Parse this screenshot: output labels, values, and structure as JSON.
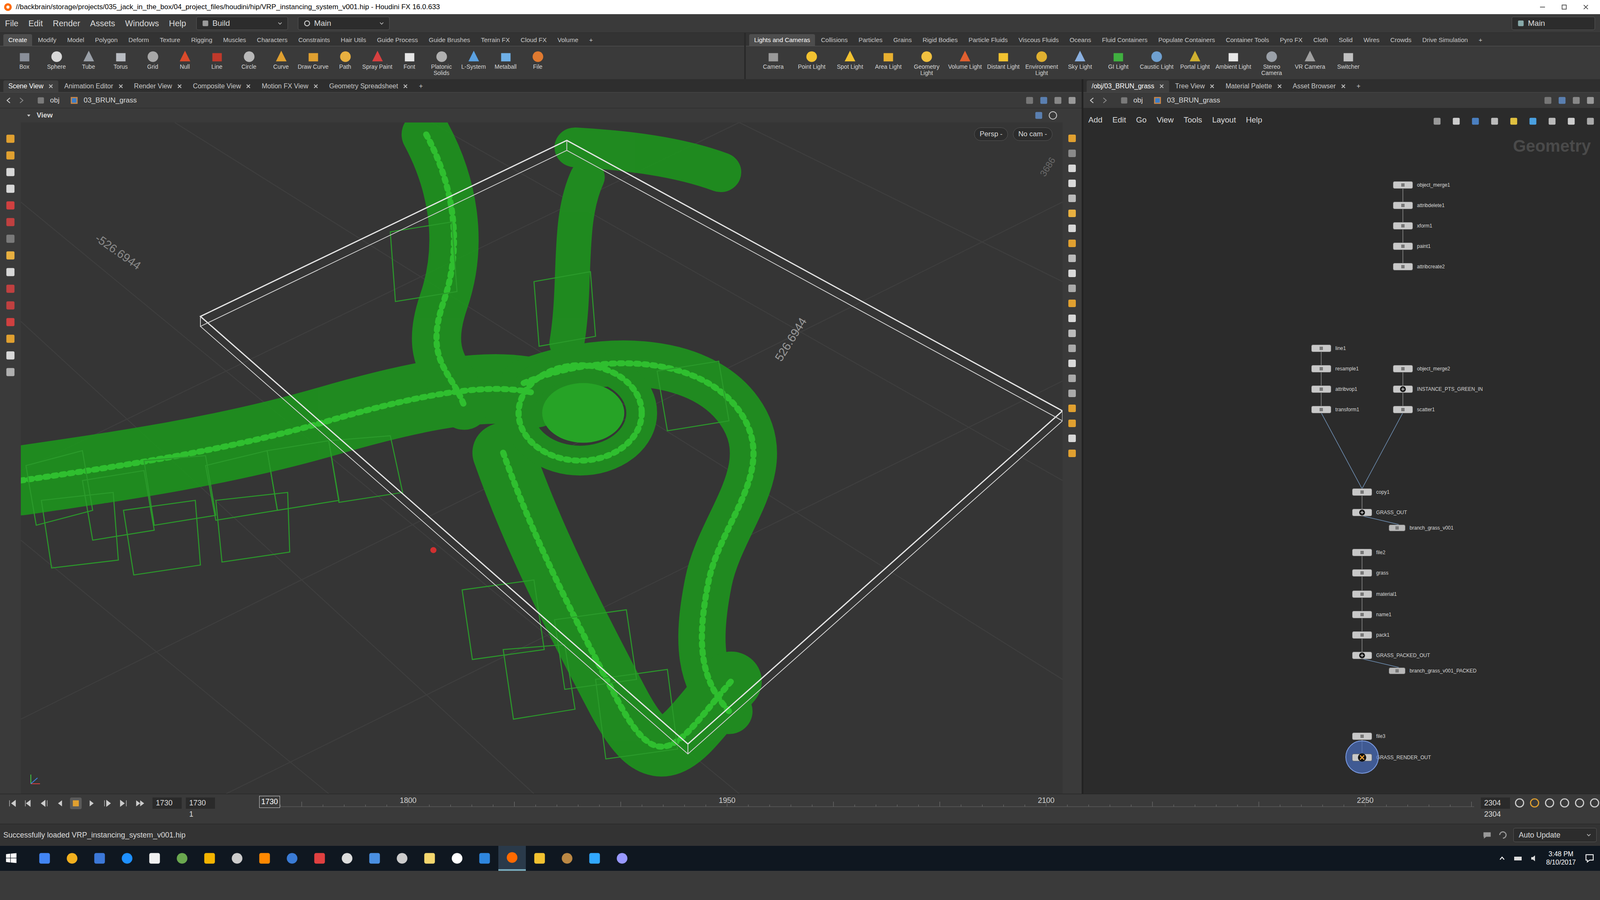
{
  "window": {
    "title": "//backbrain/storage/projects/035_jack_in_the_box/04_project_files/houdini/hip/VRP_instancing_system_v001.hip - Houdini FX 16.0.633"
  },
  "menu": [
    "File",
    "Edit",
    "Render",
    "Assets",
    "Windows",
    "Help"
  ],
  "desktops": [
    "Build",
    "Main"
  ],
  "desktop_right": "Main",
  "shelf_left": {
    "tabs": [
      {
        "label": "Create",
        "selected": true
      },
      {
        "label": "Modify",
        "selected": false
      },
      {
        "label": "Model",
        "selected": false
      },
      {
        "label": "Polygon",
        "selected": false
      },
      {
        "label": "Deform",
        "selected": false
      },
      {
        "label": "Texture",
        "selected": false
      },
      {
        "label": "Rigging",
        "selected": false
      },
      {
        "label": "Muscles",
        "selected": false
      },
      {
        "label": "Characters",
        "selected": false
      },
      {
        "label": "Constraints",
        "selected": false
      },
      {
        "label": "Hair Utils",
        "selected": false
      },
      {
        "label": "Guide Process",
        "selected": false
      },
      {
        "label": "Guide Brushes",
        "selected": false
      },
      {
        "label": "Terrain FX",
        "selected": false
      },
      {
        "label": "Cloud FX",
        "selected": false
      },
      {
        "label": "Volume",
        "selected": false
      },
      {
        "label": "+",
        "selected": false
      }
    ],
    "tools": [
      "Box",
      "Sphere",
      "Tube",
      "Torus",
      "Grid",
      "Null",
      "Line",
      "Circle",
      "Curve",
      "Draw Curve",
      "Path",
      "Spray Paint",
      "Font",
      "Platonic Solids",
      "L-System",
      "Metaball",
      "File"
    ]
  },
  "shelf_right": {
    "tabs": [
      {
        "label": "Lights and Cameras",
        "selected": true
      },
      {
        "label": "Collisions",
        "selected": false
      },
      {
        "label": "Particles",
        "selected": false
      },
      {
        "label": "Grains",
        "selected": false
      },
      {
        "label": "Rigid Bodies",
        "selected": false
      },
      {
        "label": "Particle Fluids",
        "selected": false
      },
      {
        "label": "Viscous Fluids",
        "selected": false
      },
      {
        "label": "Oceans",
        "selected": false
      },
      {
        "label": "Fluid Containers",
        "selected": false
      },
      {
        "label": "Populate Containers",
        "selected": false
      },
      {
        "label": "Container Tools",
        "selected": false
      },
      {
        "label": "Pyro FX",
        "selected": false
      },
      {
        "label": "Cloth",
        "selected": false
      },
      {
        "label": "Solid",
        "selected": false
      },
      {
        "label": "Wires",
        "selected": false
      },
      {
        "label": "Crowds",
        "selected": false
      },
      {
        "label": "Drive Simulation",
        "selected": false
      },
      {
        "label": "+",
        "selected": false
      }
    ],
    "tools": [
      "Camera",
      "Point Light",
      "Spot Light",
      "Area Light",
      "Geometry Light",
      "Volume Light",
      "Distant Light",
      "Environment Light",
      "Sky Light",
      "GI Light",
      "Caustic Light",
      "Portal Light",
      "Ambient Light",
      "Stereo Camera",
      "VR Camera",
      "Switcher"
    ]
  },
  "left_pane": {
    "tabs": [
      {
        "label": "Scene View",
        "selected": true
      },
      {
        "label": "Animation Editor",
        "selected": false
      },
      {
        "label": "Render View",
        "selected": false
      },
      {
        "label": "Composite View",
        "selected": false
      },
      {
        "label": "Motion FX View",
        "selected": false
      },
      {
        "label": "Geometry Spreadsheet",
        "selected": false
      },
      {
        "label": "+",
        "selected": false
      }
    ],
    "path": [
      "obj",
      "03_BRUN_grass"
    ],
    "header": "View",
    "persp": "Persp -",
    "camera": "No cam -",
    "dims": [
      "-526.6944",
      "526.6944",
      "3686"
    ]
  },
  "right_pane": {
    "tabs": [
      {
        "label": "/obj/03_BRUN_grass",
        "selected": true
      },
      {
        "label": "Tree View",
        "selected": false
      },
      {
        "label": "Material Palette",
        "selected": false
      },
      {
        "label": "Asset Browser",
        "selected": false
      },
      {
        "label": "+",
        "selected": false
      }
    ],
    "path": [
      "obj",
      "03_BRUN_grass"
    ],
    "menu": [
      "Add",
      "Edit",
      "Go",
      "View",
      "Tools",
      "Layout",
      "Help"
    ]
  },
  "network": {
    "context": "Geometry",
    "nodes": [
      {
        "name": "object_merge1",
        "kind": "sop"
      },
      {
        "name": "attribdelete1",
        "kind": "sop"
      },
      {
        "name": "xform1",
        "kind": "sop"
      },
      {
        "name": "paint1",
        "kind": "sop"
      },
      {
        "name": "attribcreate2",
        "kind": "sop"
      },
      {
        "name": "line1",
        "kind": "sop"
      },
      {
        "name": "resample1",
        "kind": "sop"
      },
      {
        "name": "attribvop1",
        "kind": "sop"
      },
      {
        "name": "transform1",
        "kind": "sop"
      },
      {
        "name": "object_merge2",
        "kind": "sop"
      },
      {
        "name": "INSTANCE_PTS_GREEN_IN",
        "kind": "null"
      },
      {
        "name": "scatter1",
        "kind": "sop"
      },
      {
        "name": "copy1",
        "kind": "sop"
      },
      {
        "name": "GRASS_OUT",
        "kind": "null"
      },
      {
        "name": "branch_grass_v001",
        "kind": "rop"
      },
      {
        "name": "file2",
        "kind": "sop"
      },
      {
        "name": "grass",
        "kind": "sop"
      },
      {
        "name": "material1",
        "kind": "sop"
      },
      {
        "name": "name1",
        "kind": "sop"
      },
      {
        "name": "pack1",
        "kind": "sop"
      },
      {
        "name": "GRASS_PACKED_OUT",
        "kind": "null"
      },
      {
        "name": "branch_grass_v001_PACKED",
        "kind": "rop"
      },
      {
        "name": "file3",
        "kind": "sop"
      },
      {
        "name": "GRASS_RENDER_OUT",
        "kind": "display"
      }
    ]
  },
  "timeline": {
    "frame": "1730",
    "start": "1730",
    "start_sub": "1",
    "current": "1730",
    "ticks": [
      "1800",
      "1950",
      "2100",
      "2250"
    ],
    "end": "2304",
    "end_sub": "2304"
  },
  "status": {
    "message": "Successfully loaded VRP_instancing_system_v001.hip",
    "update_mode": "Auto Update"
  },
  "taskbar": {
    "time": "3:48 PM",
    "date": "8/10/2017"
  }
}
